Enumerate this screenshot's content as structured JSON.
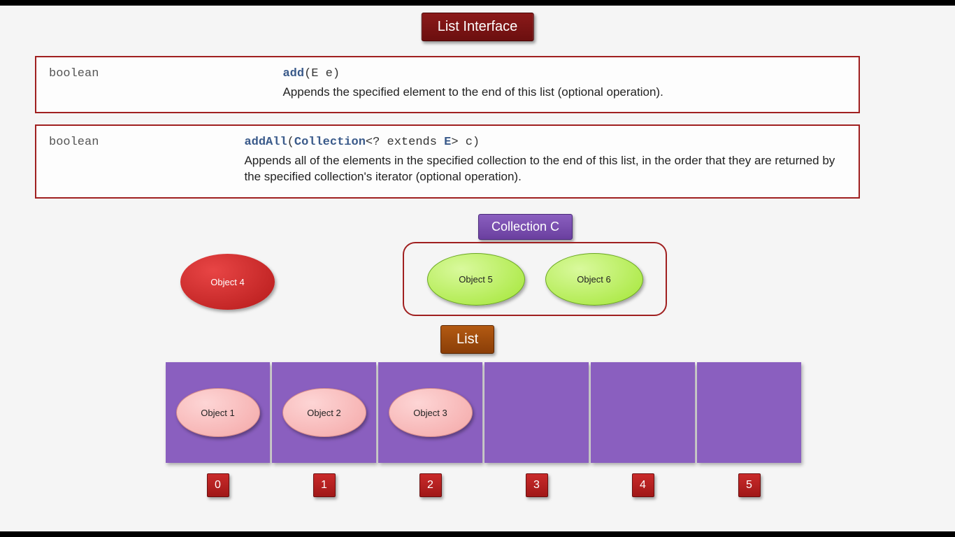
{
  "title": "List Interface",
  "methods": [
    {
      "returnType": "boolean",
      "sigBold": "add",
      "sigRest": "(E e)",
      "desc": "Appends the specified element to the end of this list (optional operation)."
    },
    {
      "returnType": "boolean",
      "sigBold1": "addAll",
      "sigMid1": "(",
      "sigBold2": "Collection",
      "sigMid2": "<? extends ",
      "sigBold3": "E",
      "sigMid3": "> c)",
      "desc": "Appends all of the elements in the specified collection to the end of this list, in the order that they are returned by the specified collection's iterator (optional operation)."
    }
  ],
  "collectionLabel": "Collection C",
  "collectionItems": [
    "Object 5",
    "Object 6"
  ],
  "looseObject": "Object 4",
  "listLabel": "List",
  "listCells": [
    "Object 1",
    "Object 2",
    "Object 3",
    "",
    "",
    ""
  ],
  "indices": [
    "0",
    "1",
    "2",
    "3",
    "4",
    "5"
  ]
}
